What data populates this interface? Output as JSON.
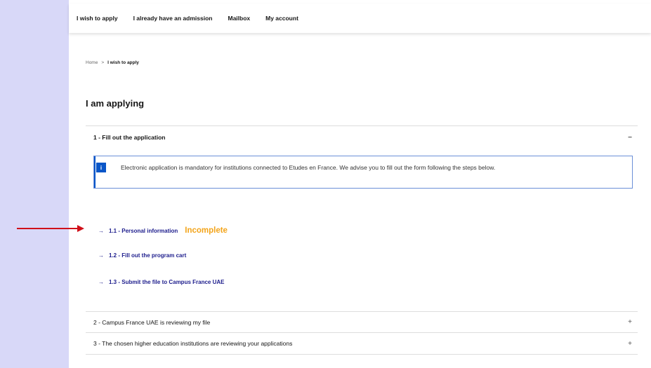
{
  "nav": {
    "items": [
      "I wish to apply",
      "I already have an admission",
      "Mailbox",
      "My account"
    ]
  },
  "breadcrumb": {
    "home": "Home",
    "separator": ">",
    "current": "I wish to apply"
  },
  "page_title": "I am applying",
  "accordion": {
    "section1": {
      "label": "1 - Fill out the application",
      "toggle": "−"
    },
    "info": {
      "icon": "i",
      "text": "Electronic application is mandatory for institutions connected to Etudes en France. We advise you to fill out the form following the steps below."
    },
    "steps": [
      {
        "arrow": "→",
        "label": "1.1 - Personal information",
        "status": "Incomplete"
      },
      {
        "arrow": "→",
        "label": "1.2 - Fill out the program cart"
      },
      {
        "arrow": "→",
        "label": "1.3 - Submit the file to Campus France UAE"
      }
    ],
    "section2": {
      "label": "2 - Campus France UAE is reviewing my file",
      "toggle": "+"
    },
    "section3": {
      "label": "3 - The chosen higher education institutions are reviewing your applications",
      "toggle": "+"
    }
  },
  "colors": {
    "background": "#d8d8f8",
    "link": "#1c1c8c",
    "status_incomplete": "#f3a41a",
    "info_accent": "#0a56c8",
    "pointer_arrow": "#d0101a"
  }
}
